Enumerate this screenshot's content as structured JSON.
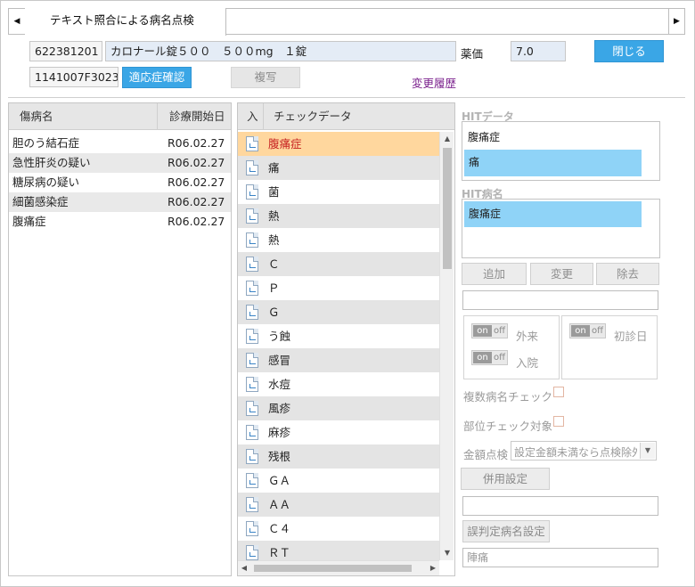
{
  "tabs": {
    "left_arrow": "◀",
    "right_arrow": "▶",
    "active_title": "テキスト照合による病名点検"
  },
  "header": {
    "code1": "622381201",
    "drug_name": "カロナール錠５００　５００mg　１錠",
    "price_label": "薬価",
    "price_value": "7.0",
    "close_button": "閉じる",
    "code2": "1141007F3023",
    "indication_button": "適応症確認",
    "copy_button": "複写",
    "history_link": "変更履歴"
  },
  "disease_table": {
    "headers": [
      "傷病名",
      "診療開始日"
    ],
    "rows": [
      [
        "胆のう結石症",
        "R06.02.27"
      ],
      [
        "急性肝炎の疑い",
        "R06.02.27"
      ],
      [
        "糖尿病の疑い",
        "R06.02.27"
      ],
      [
        "細菌感染症",
        "R06.02.27"
      ],
      [
        "腹痛症",
        "R06.02.27"
      ]
    ]
  },
  "check_list": {
    "header_in": "入",
    "header_data": "チェックデータ",
    "items": [
      "腹痛症",
      "痛",
      "菌",
      "熱",
      "熱",
      "Ｃ",
      "Ｐ",
      "Ｇ",
      "う蝕",
      "感冒",
      "水痘",
      "風疹",
      "麻疹",
      "残根",
      "ＧＡ",
      "ＡＡ",
      "Ｃ４",
      "ＲＴ"
    ],
    "selected_index": 0
  },
  "right_panel": {
    "hit_data_title": "HITデータ",
    "hit_data_text": "腹痛症",
    "hit_data_highlight": "痛",
    "hit_disease_title": "HIT病名",
    "hit_disease_highlight": "腹痛症",
    "add_button": "追加",
    "change_button": "変更",
    "remove_button": "除去",
    "toggle_on": "on",
    "toggle_off": "off",
    "outpatient_label": "外来",
    "inpatient_label": "入院",
    "first_visit_label": "初診日",
    "multi_disease_check_label": "複数病名チェック",
    "site_check_label": "部位チェック対象",
    "amount_check_label": "金額点検",
    "amount_check_value": "設定金額未満なら点検除外",
    "concurrent_button": "併用設定",
    "misjudge_button": "誤判定病名設定",
    "bottom_field_value": "陣痛"
  }
}
